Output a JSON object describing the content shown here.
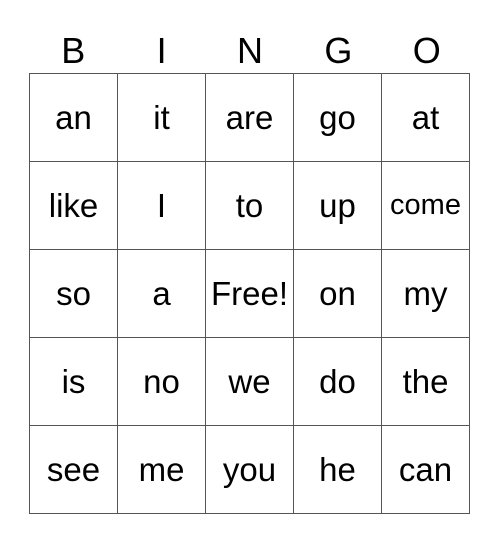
{
  "header": [
    "B",
    "I",
    "N",
    "G",
    "O"
  ],
  "rows": [
    [
      "an",
      "it",
      "are",
      "go",
      "at"
    ],
    [
      "like",
      "I",
      "to",
      "up",
      "come"
    ],
    [
      "so",
      "a",
      "Free!",
      "on",
      "my"
    ],
    [
      "is",
      "no",
      "we",
      "do",
      "the"
    ],
    [
      "see",
      "me",
      "you",
      "he",
      "can"
    ]
  ]
}
